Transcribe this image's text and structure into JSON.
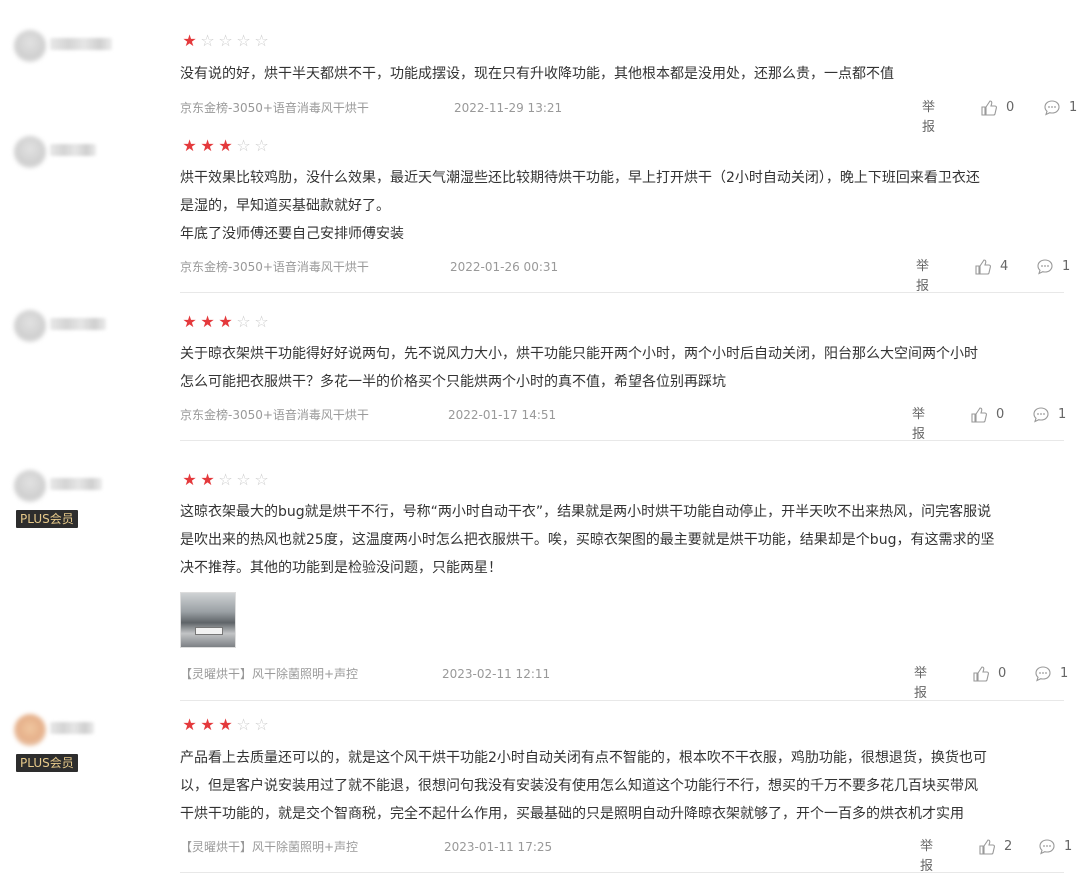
{
  "reviews": [
    {
      "rating": 1,
      "content": "没有说的好，烘干半天都烘不干，功能成摆设，现在只有升收降功能，其他根本都是没用处，还那么贵，一点都不值",
      "spec": "京东金榜-3050+语音消毒风干烘干",
      "date": "2022-11-29 13:21",
      "report_label": "举报",
      "likes": "0",
      "replies": "1",
      "plus_member": false
    },
    {
      "rating": 3,
      "content": "烘干效果比较鸡肋，没什么效果，最近天气潮湿些还比较期待烘干功能，早上打开烘干（2小时自动关闭），晚上下班回来看卫衣还\n是湿的，早知道买基础款就好了。\n年底了没师傅还要自己安排师傅安装",
      "spec": "京东金榜-3050+语音消毒风干烘干",
      "date": "2022-01-26 00:31",
      "report_label": "举报",
      "likes": "4",
      "replies": "1",
      "plus_member": false
    },
    {
      "rating": 3,
      "content": "关于晾衣架烘干功能得好好说两句，先不说风力大小，烘干功能只能开两个小时，两个小时后自动关闭，阳台那么大空间两个小时\n怎么可能把衣服烘干？多花一半的价格买个只能烘两个小时的真不值，希望各位别再踩坑",
      "spec": "京东金榜-3050+语音消毒风干烘干",
      "date": "2022-01-17 14:51",
      "report_label": "举报",
      "likes": "0",
      "replies": "1",
      "plus_member": false
    },
    {
      "rating": 2,
      "content": "这晾衣架最大的bug就是烘干不行，号称“两小时自动干衣”，结果就是两小时烘干功能自动停止，开半天吹不出来热风，问完客服说\n是吹出来的热风也就25度，这温度两小时怎么把衣服烘干。唉，买晾衣架图的最主要就是烘干功能，结果却是个bug，有这需求的坚\n决不推荐。其他的功能到是检验没问题，只能两星！",
      "spec": "【灵曜烘干】风干除菌照明+声控",
      "date": "2023-02-11 12:11",
      "report_label": "举报",
      "likes": "0",
      "replies": "1",
      "plus_member": true,
      "plus_label": "PLUS会员"
    },
    {
      "rating": 3,
      "content": "产品看上去质量还可以的，就是这个风干烘干功能2小时自动关闭有点不智能的，根本吹不干衣服，鸡肋功能，很想退货，换货也可\n以，但是客户说安装用过了就不能退，很想问句我没有安装没有使用怎么知道这个功能行不行，想买的千万不要多花几百块买带风\n干烘干功能的，就是交个智商税，完全不起什么作用，买最基础的只是照明自动升降晾衣架就够了，开个一百多的烘衣机才实用",
      "spec": "【灵曜烘干】风干除菌照明+声控",
      "date": "2023-01-11 17:25",
      "report_label": "举报",
      "likes": "2",
      "replies": "1",
      "plus_member": true,
      "plus_label": "PLUS会员"
    }
  ],
  "colors": {
    "star_on": "#e4393c",
    "star_off": "#cccccc",
    "plus_bg": "#2d2d2d",
    "plus_text": "#e6c98a"
  },
  "icons": {
    "like": "thumbs-up-icon",
    "reply": "comment-bubble-icon"
  }
}
